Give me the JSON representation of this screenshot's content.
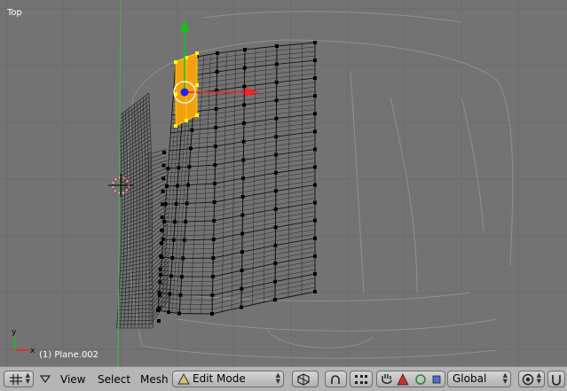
{
  "viewport": {
    "view_name": "Top",
    "object_label": "(1) Plane.002",
    "axis_gizmo": {
      "x_label": "x",
      "y_label": "y"
    }
  },
  "toolbar": {
    "menus": {
      "view": "View",
      "select": "Select",
      "mesh": "Mesh"
    },
    "mode_select": {
      "value": "Edit Mode",
      "icon": "edit-mode-icon"
    },
    "transform_orientation": {
      "value": "Global"
    },
    "icons": [
      "editor-type-grid-icon",
      "collapse-triangle-icon",
      "draw-type-icon",
      "proportional-edit-icon",
      "vertex-select-icon",
      "hand-grab-icon",
      "rotate-manipulator-icon",
      "scale-manipulator-icon",
      "pivot-icon",
      "snap-icon"
    ]
  },
  "colors": {
    "viewport_bg": "#737373",
    "grid": "#6a6a6a",
    "selection": "#ff9900",
    "manipulator_x": "#ff2020",
    "manipulator_y": "#20c020",
    "wire": "#000000",
    "toolbar_bg": "#b5b5b5"
  }
}
